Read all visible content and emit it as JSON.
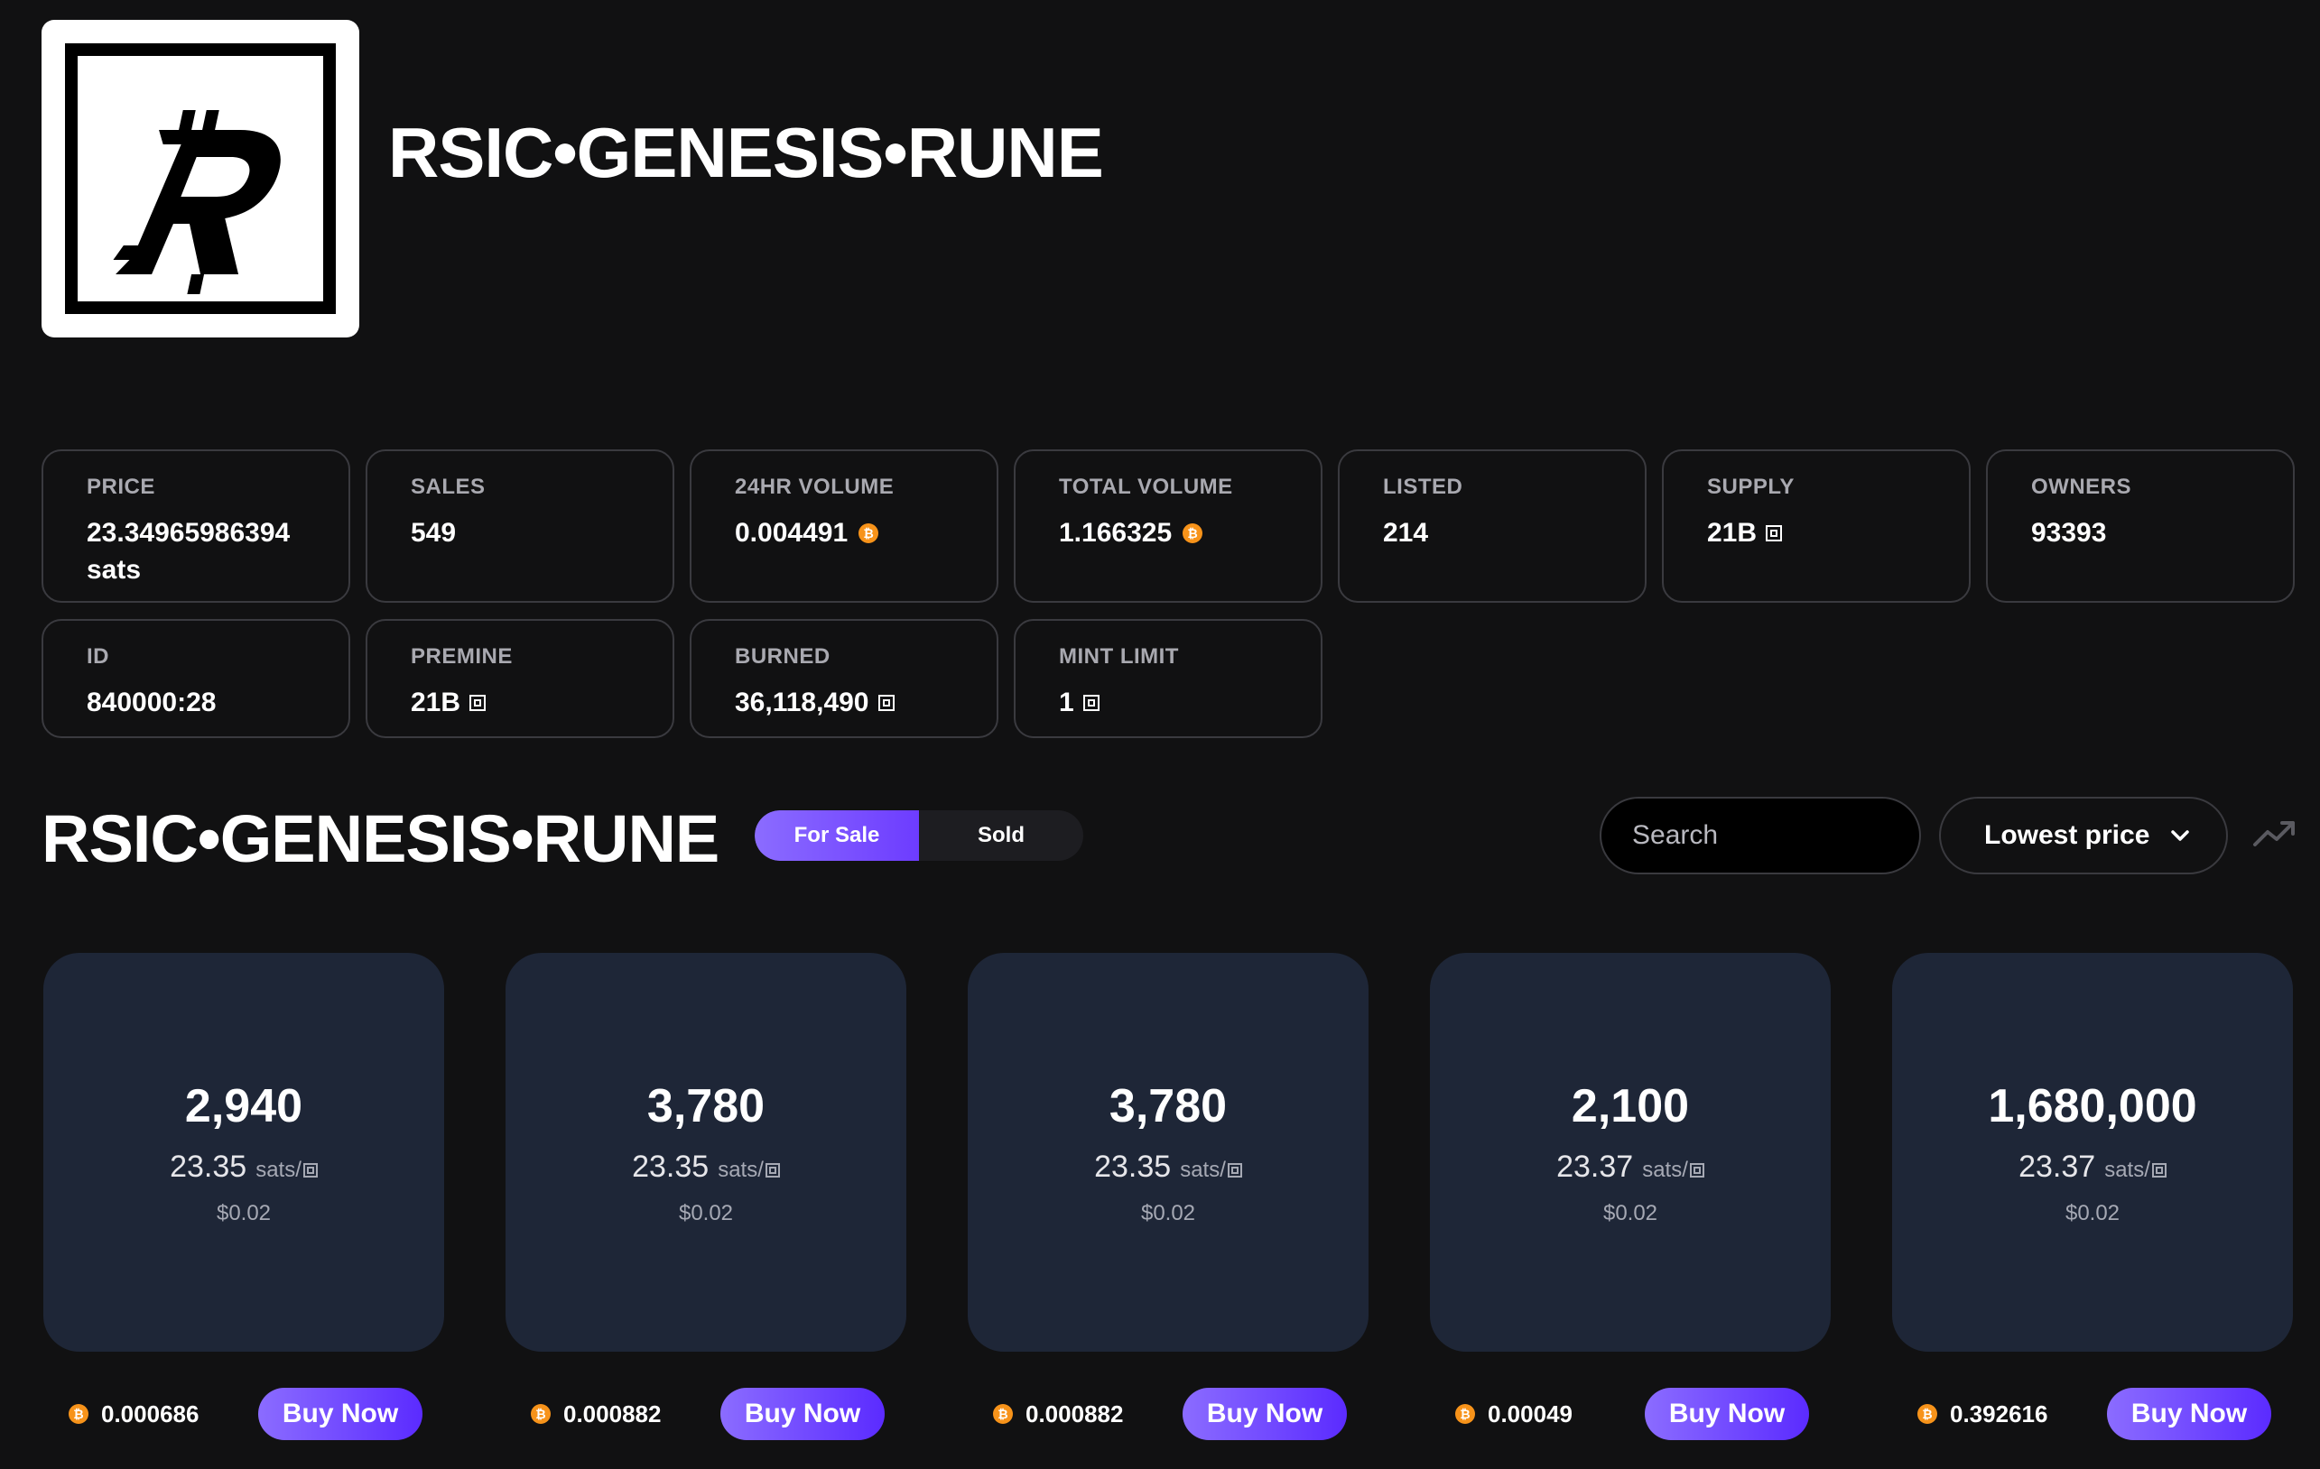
{
  "header": {
    "title": "RSIC•GENESIS•RUNE",
    "logo_icon": "rune-r-bitcoin-logo"
  },
  "stats": [
    {
      "label": "PRICE",
      "value": "23.34965986394 sats",
      "unit_icon": ""
    },
    {
      "label": "SALES",
      "value": "549",
      "unit_icon": ""
    },
    {
      "label": "24HR VOLUME",
      "value": "0.004491",
      "unit_icon": "btc-icon"
    },
    {
      "label": "TOTAL VOLUME",
      "value": "1.166325",
      "unit_icon": "btc-icon"
    },
    {
      "label": "LISTED",
      "value": "214",
      "unit_icon": ""
    },
    {
      "label": "SUPPLY",
      "value": "21B",
      "unit_icon": "rune-icon"
    },
    {
      "label": "OWNERS",
      "value": "93393",
      "unit_icon": ""
    },
    {
      "label": "ID",
      "value": "840000:28",
      "unit_icon": ""
    },
    {
      "label": "PREMINE",
      "value": "21B",
      "unit_icon": "rune-icon"
    },
    {
      "label": "BURNED",
      "value": "36,118,490",
      "unit_icon": "rune-icon"
    },
    {
      "label": "MINT LIMIT",
      "value": "1",
      "unit_icon": "rune-icon"
    }
  ],
  "listing": {
    "title": "RSIC•GENESIS•RUNE",
    "tabs": [
      {
        "label": "For Sale",
        "active": true
      },
      {
        "label": "Sold",
        "active": false
      }
    ],
    "search": {
      "placeholder": "Search",
      "value": ""
    },
    "sort": {
      "selected": "Lowest price"
    },
    "unit_label": "sats/",
    "buy_label": "Buy Now"
  },
  "cards": [
    {
      "amount": "2,940",
      "rate": "23.35",
      "usd": "$0.02",
      "btc": "0.000686"
    },
    {
      "amount": "3,780",
      "rate": "23.35",
      "usd": "$0.02",
      "btc": "0.000882"
    },
    {
      "amount": "3,780",
      "rate": "23.35",
      "usd": "$0.02",
      "btc": "0.000882"
    },
    {
      "amount": "2,100",
      "rate": "23.37",
      "usd": "$0.02",
      "btc": "0.00049"
    },
    {
      "amount": "1,680,000",
      "rate": "23.37",
      "usd": "$0.02",
      "btc": "0.392616"
    }
  ],
  "colors": {
    "background": "#111112",
    "card": "#1e2637",
    "accent": "#7b52ff",
    "btc": "#f7931a"
  }
}
